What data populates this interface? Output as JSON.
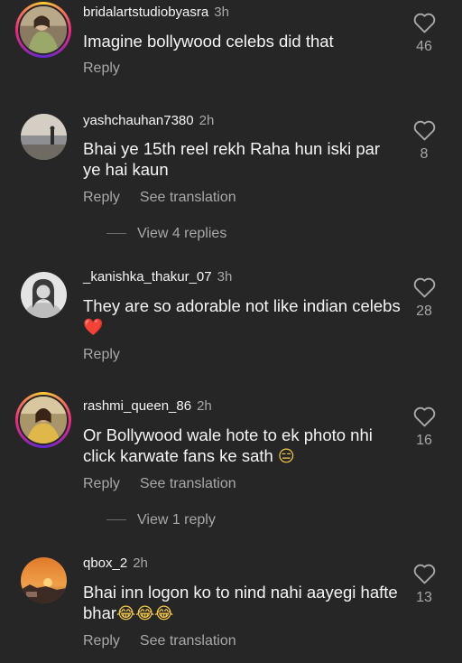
{
  "comments": [
    {
      "username": "bridalartstudiobyasra",
      "time": "3h",
      "text": "Imagine bollywood celebs did that",
      "likes": "46",
      "actions": {
        "reply": "Reply"
      }
    },
    {
      "username": "yashchauhan7380",
      "time": "2h",
      "text": "Bhai ye 15th reel rekh Raha hun iski par ye hai kaun",
      "likes": "8",
      "actions": {
        "reply": "Reply",
        "translate": "See translation"
      },
      "view_replies": "View 4 replies"
    },
    {
      "username": "_kanishka_thakur_07",
      "time": "3h",
      "text": "They are so adorable not like indian celebs",
      "text_emoji": "❤️",
      "likes": "28",
      "actions": {
        "reply": "Reply"
      }
    },
    {
      "username": "rashmi_queen_86",
      "time": "2h",
      "text": "Or Bollywood wale hote to ek photo nhi click karwate fans ke sath",
      "text_emoji": "😑",
      "likes": "16",
      "actions": {
        "reply": "Reply",
        "translate": "See translation"
      },
      "view_replies": "View 1 reply"
    },
    {
      "username": "qbox_2",
      "time": "2h",
      "text": "Bhai inn logon ko to nind nahi aayegi hafte bhar",
      "text_emoji": "😂😂😂",
      "likes": "13",
      "actions": {
        "reply": "Reply",
        "translate": "See translation"
      }
    }
  ],
  "colors": {
    "background": "#262626",
    "primary_text": "#f5f5f5",
    "secondary_text": "#a8a8a8",
    "heart_emoji": "#e0245e"
  },
  "icons": {
    "like": "heart-outline-icon"
  }
}
